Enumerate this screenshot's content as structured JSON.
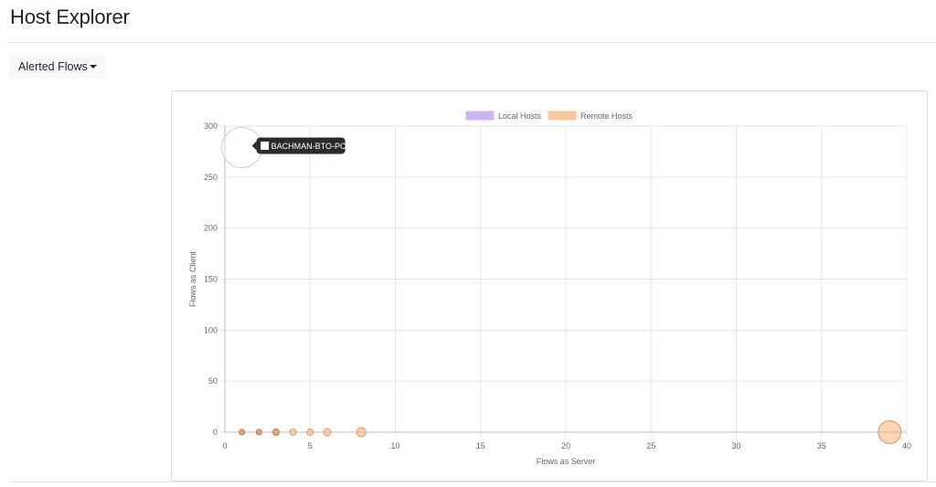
{
  "page": {
    "title": "Host Explorer"
  },
  "filter": {
    "label": "Alerted Flows"
  },
  "tooltip": {
    "label": "BACHMAN-BTO-PC"
  },
  "colors": {
    "local": "#ceb4f3",
    "remote": "#f9c79b",
    "remote_point": "#f6b27a",
    "remote_border": "#e8935a",
    "grid": "#e6e6e6",
    "tooltip_bg": "#2b2b2b"
  },
  "chart_data": {
    "type": "scatter",
    "xlabel": "Flows as Server",
    "ylabel": "Flows as Client",
    "xlim": [
      0,
      40
    ],
    "ylim": [
      0,
      300
    ],
    "xticks": [
      0,
      5,
      10,
      15,
      20,
      25,
      30,
      35,
      40
    ],
    "yticks": [
      0,
      50,
      100,
      150,
      200,
      250,
      300
    ],
    "grid": true,
    "legend_position": "top",
    "series": [
      {
        "name": "Local Hosts",
        "color": "#ceb4f3",
        "points": [
          {
            "x": 1,
            "y": 279,
            "size": 22,
            "label": "BACHMAN-BTO-PC",
            "highlighted": true
          }
        ]
      },
      {
        "name": "Remote Hosts",
        "color": "#f9c79b",
        "points": [
          {
            "x": 1,
            "y": 0,
            "size": 3,
            "strong": true
          },
          {
            "x": 2,
            "y": 0,
            "size": 3,
            "strong": true
          },
          {
            "x": 3,
            "y": 0,
            "size": 3.5,
            "strong": true
          },
          {
            "x": 4,
            "y": 0,
            "size": 3.5
          },
          {
            "x": 5,
            "y": 0,
            "size": 3.5
          },
          {
            "x": 6,
            "y": 0,
            "size": 4
          },
          {
            "x": 8,
            "y": 0,
            "size": 5
          },
          {
            "x": 39,
            "y": 0,
            "size": 12.5
          }
        ]
      }
    ]
  }
}
